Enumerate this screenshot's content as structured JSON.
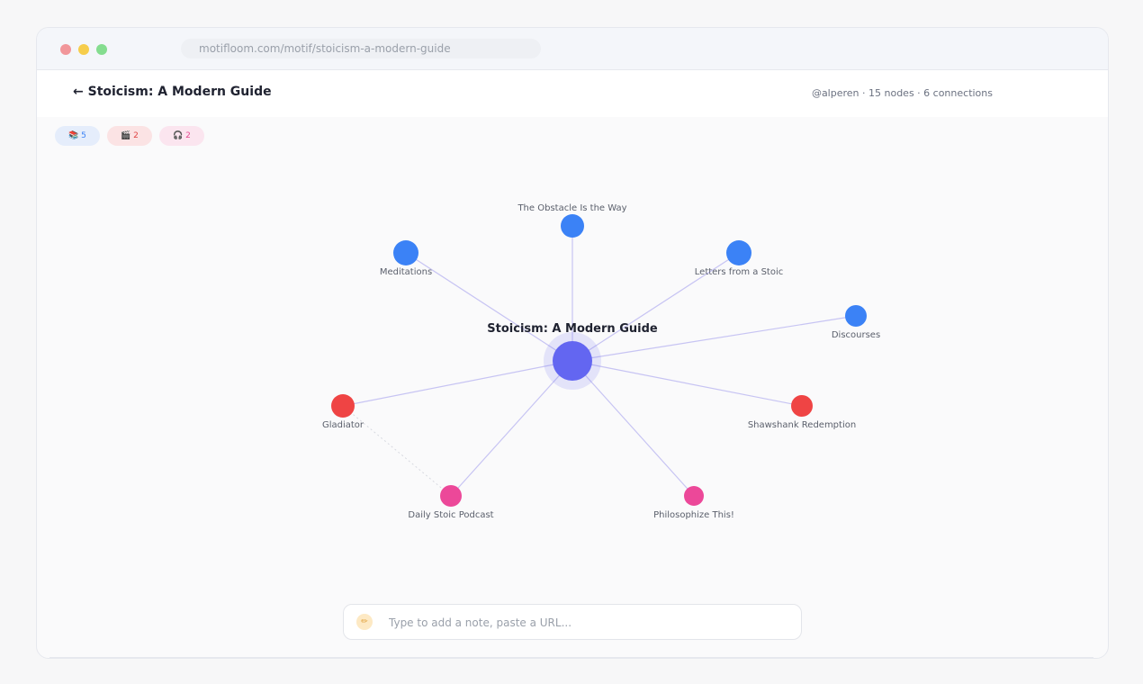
{
  "browser": {
    "url": "motifloom.com/motif/stoicism-a-modern-guide"
  },
  "header": {
    "title": "← Stoicism: A Modern Guide",
    "meta": "@alperen · 15 nodes · 6 connections"
  },
  "chips": [
    {
      "label": "📚 5"
    },
    {
      "label": "🎬 2"
    },
    {
      "label": "🎧 2"
    }
  ],
  "graph": {
    "center": {
      "label": "Stoicism: A Modern Guide",
      "color": "#6366f1"
    },
    "nodes": [
      {
        "label": "The Obstacle Is the Way",
        "type": "book",
        "color": "#3b82f6"
      },
      {
        "label": "Meditations",
        "type": "book",
        "color": "#3b82f6"
      },
      {
        "label": "Letters from a Stoic",
        "type": "book",
        "color": "#3b82f6"
      },
      {
        "label": "Discourses",
        "type": "book",
        "color": "#3b82f6"
      },
      {
        "label": "Gladiator",
        "type": "film",
        "color": "#ef4444"
      },
      {
        "label": "Shawshank Redemption",
        "type": "film",
        "color": "#ef4444"
      },
      {
        "label": "Daily Stoic Podcast",
        "type": "podcast",
        "color": "#ec4899"
      },
      {
        "label": "Philosophize This!",
        "type": "podcast",
        "color": "#ec4899"
      }
    ]
  },
  "note": {
    "placeholder": "Type to add a note, paste a URL...",
    "icon": "pencil-icon"
  }
}
